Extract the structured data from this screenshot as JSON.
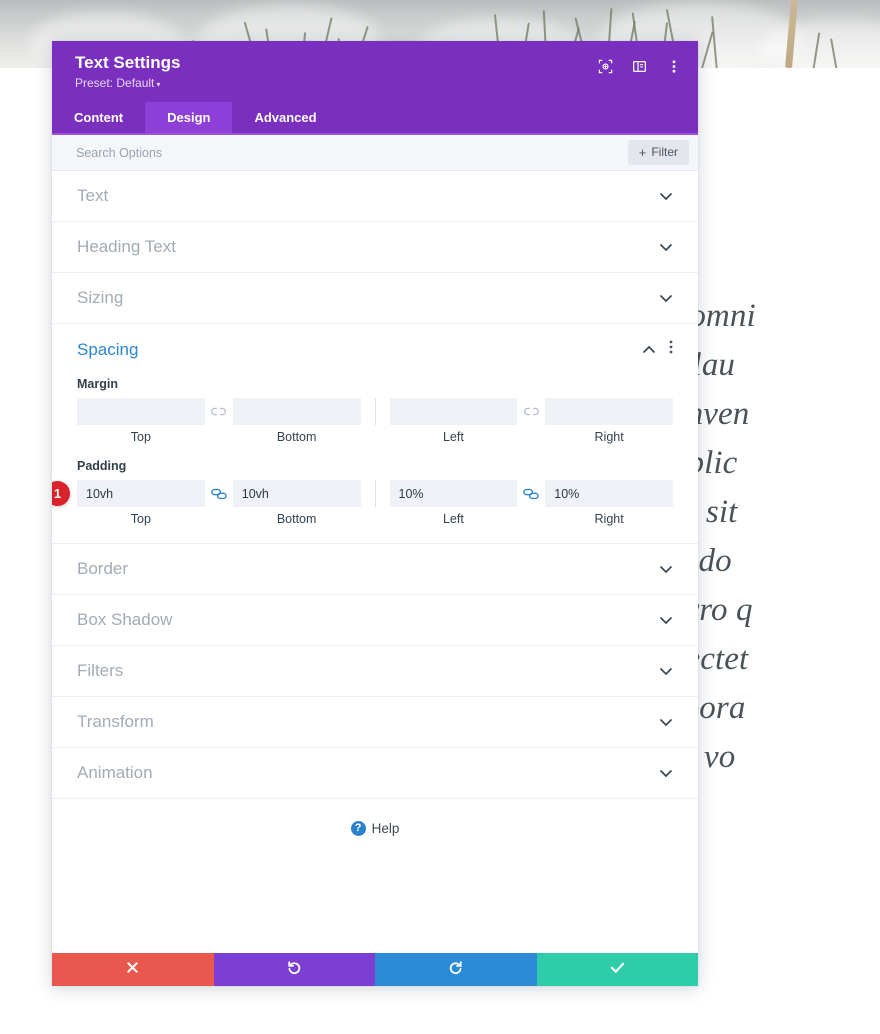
{
  "background": {
    "article_lines": [
      "utis unde omni",
      "loremque lau",
      "e ab illo inven",
      "ta sunt explic",
      "a voluptas sit",
      "tur magni do",
      "Neque porro q",
      "met, consectet",
      "modi tempora",
      "m quaerat vo"
    ]
  },
  "modal": {
    "title": "Text Settings",
    "preset_label": "Preset: Default",
    "preset_caret": "▾",
    "header_icons": [
      {
        "name": "focus-target-icon",
        "label": "Focus"
      },
      {
        "name": "layout-panel-icon",
        "label": "Panel Layout"
      },
      {
        "name": "more-vertical-icon",
        "label": "More Options"
      }
    ],
    "tabs": [
      {
        "label": "Content",
        "active": false
      },
      {
        "label": "Design",
        "active": true
      },
      {
        "label": "Advanced",
        "active": false
      }
    ],
    "search": {
      "value": "",
      "placeholder": "Search Options"
    },
    "filter_button": {
      "plus": "+",
      "label": "Filter"
    },
    "sections": [
      {
        "label": "Text",
        "state": "collapsed"
      },
      {
        "label": "Heading Text",
        "state": "collapsed"
      },
      {
        "label": "Sizing",
        "state": "collapsed"
      }
    ],
    "spacing": {
      "label": "Spacing",
      "state": "expanded",
      "groups": [
        {
          "label": "Margin",
          "link_left": {
            "state": "unlinked"
          },
          "link_right": {
            "state": "unlinked"
          },
          "badge": null,
          "fields": [
            {
              "caption": "Top",
              "value": ""
            },
            {
              "caption": "Bottom",
              "value": ""
            },
            {
              "caption": "Left",
              "value": ""
            },
            {
              "caption": "Right",
              "value": ""
            }
          ]
        },
        {
          "label": "Padding",
          "link_left": {
            "state": "linked"
          },
          "link_right": {
            "state": "linked"
          },
          "badge": "1",
          "fields": [
            {
              "caption": "Top",
              "value": "10vh"
            },
            {
              "caption": "Bottom",
              "value": "10vh"
            },
            {
              "caption": "Left",
              "value": "10%"
            },
            {
              "caption": "Right",
              "value": "10%"
            }
          ]
        }
      ]
    },
    "sections_after": [
      {
        "label": "Border",
        "state": "collapsed"
      },
      {
        "label": "Box Shadow",
        "state": "collapsed"
      },
      {
        "label": "Filters",
        "state": "collapsed"
      },
      {
        "label": "Transform",
        "state": "collapsed"
      },
      {
        "label": "Animation",
        "state": "collapsed"
      }
    ],
    "help": {
      "icon_glyph": "?",
      "label": "Help"
    },
    "footer_buttons": [
      {
        "name": "cancel-button",
        "icon": "close-icon",
        "color": "#E8584F"
      },
      {
        "name": "undo-button",
        "icon": "undo-icon",
        "color": "#7B3FD4"
      },
      {
        "name": "redo-button",
        "icon": "redo-icon",
        "color": "#2C8BD6"
      },
      {
        "name": "save-button",
        "icon": "check-icon",
        "color": "#2ECCA8"
      }
    ]
  },
  "colors": {
    "header_purple": "#7B2FBE",
    "tab_active": "#8E3FD8",
    "accent_blue": "#2C87CB",
    "badge_red": "#D8232A"
  }
}
